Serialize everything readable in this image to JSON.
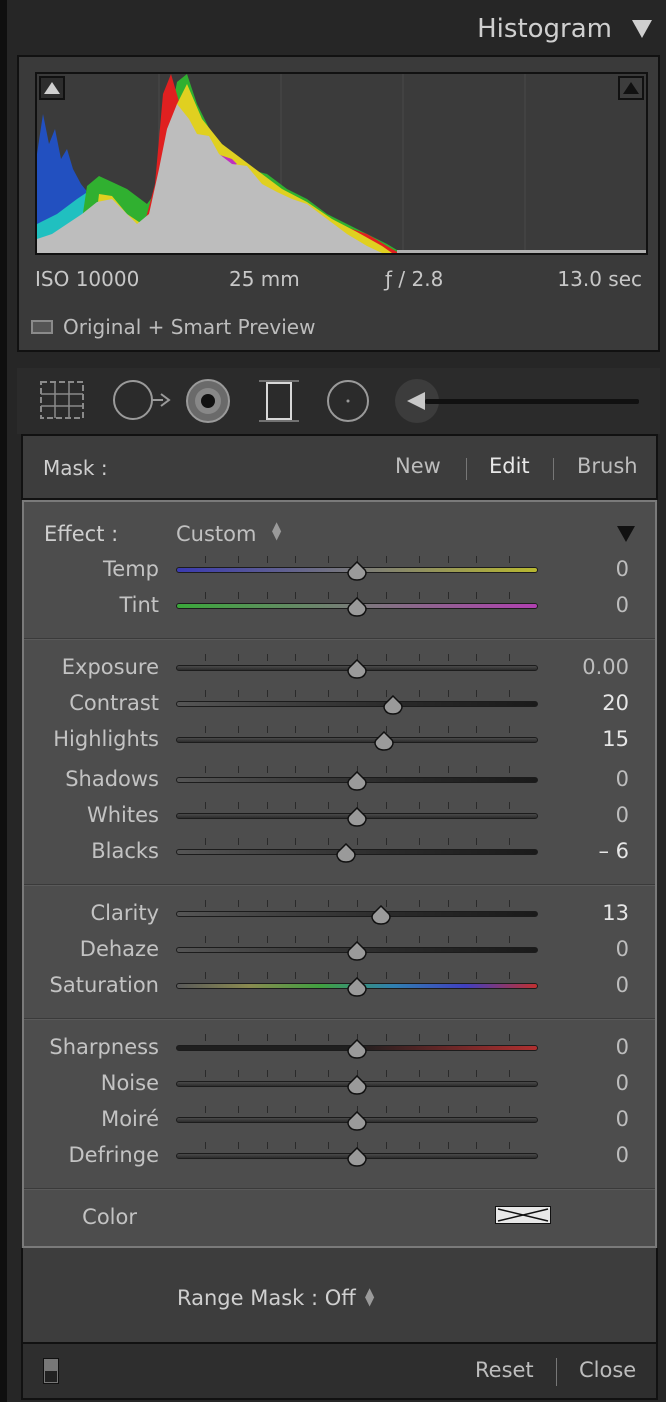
{
  "histogram": {
    "title": "Histogram",
    "iso": "ISO 10000",
    "focal_length": "25 mm",
    "aperture": "ƒ / 2.8",
    "shutter": "13.0 sec",
    "preview_status": "Original + Smart Preview"
  },
  "tools": {
    "crop_icon": "crop-overlay-icon",
    "spot_icon": "spot-removal-icon",
    "redeye_icon": "red-eye-icon",
    "graduated_icon": "graduated-filter-icon",
    "radial_icon": "radial-filter-icon",
    "brush_icon": "adjustment-brush-icon"
  },
  "mask": {
    "label": "Mask :",
    "new_label": "New",
    "edit_label": "Edit",
    "brush_label": "Brush"
  },
  "effect": {
    "label": "Effect :",
    "value": "Custom"
  },
  "sliders": {
    "temp": {
      "label": "Temp",
      "value": "0",
      "position": 0.5
    },
    "tint": {
      "label": "Tint",
      "value": "0",
      "position": 0.5
    },
    "exposure": {
      "label": "Exposure",
      "value": "0.00",
      "position": 0.5
    },
    "contrast": {
      "label": "Contrast",
      "value": "20",
      "position": 0.6
    },
    "highlights": {
      "label": "Highlights",
      "value": "15",
      "position": 0.575
    },
    "shadows": {
      "label": "Shadows",
      "value": "0",
      "position": 0.5
    },
    "whites": {
      "label": "Whites",
      "value": "0",
      "position": 0.5
    },
    "blacks": {
      "label": "Blacks",
      "value": "– 6",
      "position": 0.47
    },
    "clarity": {
      "label": "Clarity",
      "value": "13",
      "position": 0.565
    },
    "dehaze": {
      "label": "Dehaze",
      "value": "0",
      "position": 0.5
    },
    "saturation": {
      "label": "Saturation",
      "value": "0",
      "position": 0.5
    },
    "sharpness": {
      "label": "Sharpness",
      "value": "0",
      "position": 0.5
    },
    "noise": {
      "label": "Noise",
      "value": "0",
      "position": 0.5
    },
    "moire": {
      "label": "Moiré",
      "value": "0",
      "position": 0.5
    },
    "defringe": {
      "label": "Defringe",
      "value": "0",
      "position": 0.5
    }
  },
  "color": {
    "label": "Color"
  },
  "range_mask": {
    "label": "Range Mask : Off"
  },
  "footer": {
    "reset_label": "Reset",
    "close_label": "Close"
  },
  "colors": {
    "panel": "#4d4d4d",
    "temp_gradient": [
      "#3a3ab0",
      "#b8b830"
    ],
    "tint_gradient": [
      "#3aa83a",
      "#b040b0"
    ],
    "sharpness_end": "#b03030"
  }
}
